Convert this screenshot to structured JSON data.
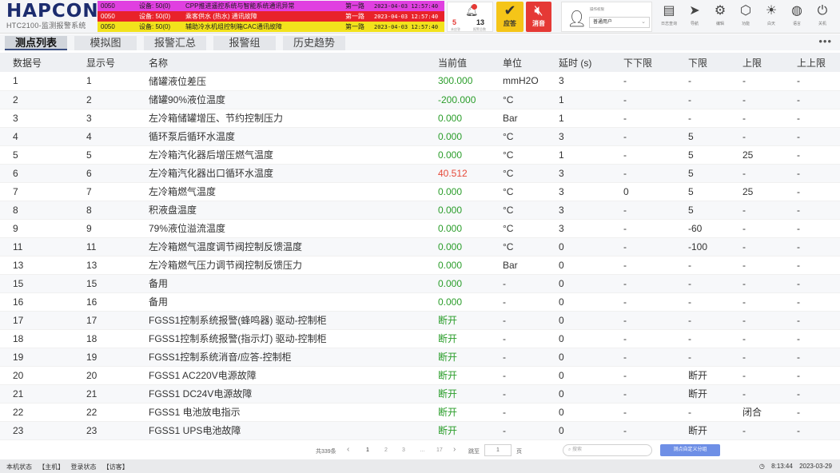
{
  "header": {
    "logo": "HAPCON",
    "subtitle": "HTC2100-监测报警系统"
  },
  "alarms": [
    {
      "id": "0050",
      "device": "设备: 50(0)",
      "message": "CPP推进遥控系统与智能系统通讯异常",
      "route": "第一路",
      "time": "2023-04-03 12:57:40",
      "bg": "#e040e0",
      "fg": "#1a1a1a"
    },
    {
      "id": "0050",
      "device": "设备: 50(0)",
      "message": "乘客供水 (热水) 通讯故障",
      "route": "第一路",
      "time": "2023-04-03 12:57:40",
      "bg": "#e8222a",
      "fg": "#ffffff"
    },
    {
      "id": "0050",
      "device": "设备: 50(0)",
      "message": "辅助冷水机组控制箱CAC通讯故障",
      "route": "第一路",
      "time": "2023-04-03 12:57:40",
      "bg": "#f2e21c",
      "fg": "#1a1a1a"
    }
  ],
  "counters": {
    "unacked": "5",
    "unacked_label": "未应答",
    "total": "13",
    "total_label": "报警总数"
  },
  "buttons": {
    "ack": "应答",
    "mute": "消音"
  },
  "user": {
    "label": "操作权限",
    "role": "普通用户"
  },
  "tools": [
    {
      "icon": "log-icon",
      "glyph": "▤",
      "label": "日志查询"
    },
    {
      "icon": "navigation-icon",
      "glyph": "➤",
      "label": "导航"
    },
    {
      "icon": "edit-gear-icon",
      "glyph": "⚙",
      "label": "编辑"
    },
    {
      "icon": "function-cube-icon",
      "glyph": "⬡",
      "label": "功能"
    },
    {
      "icon": "daytime-sun-icon",
      "glyph": "☀",
      "label": "白天"
    },
    {
      "icon": "language-icon",
      "glyph": "◍",
      "label": "语言"
    },
    {
      "icon": "power-icon",
      "glyph": "⏻",
      "label": "关机"
    }
  ],
  "tabs": [
    "测点列表",
    "模拟图",
    "报警汇总",
    "报警组",
    "历史趋势"
  ],
  "active_tab": 0,
  "table": {
    "headers": [
      "数据号",
      "显示号",
      "名称",
      "当前值",
      "单位",
      "延时 (s)",
      "下下限",
      "下限",
      "上限",
      "上上限"
    ],
    "rows": [
      [
        "1",
        "1",
        "储罐液位差压",
        "300.000",
        "mmH2O",
        "3",
        "-",
        "-",
        "-",
        "-"
      ],
      [
        "2",
        "2",
        "储罐90%液位温度",
        "-200.000",
        "°C",
        "1",
        "-",
        "-",
        "-",
        "-"
      ],
      [
        "3",
        "3",
        "左冷箱储罐增压、节约控制压力",
        "0.000",
        "Bar",
        "1",
        "-",
        "-",
        "-",
        "-"
      ],
      [
        "4",
        "4",
        "循环泵后循环水温度",
        "0.000",
        "°C",
        "3",
        "-",
        "5",
        "-",
        "-"
      ],
      [
        "5",
        "5",
        "左冷箱汽化器后增压燃气温度",
        "0.000",
        "°C",
        "1",
        "-",
        "5",
        "25",
        "-"
      ],
      [
        "6",
        "6",
        "左冷箱汽化器出口循环水温度",
        "40.512",
        "°C",
        "3",
        "-",
        "5",
        "-",
        "-"
      ],
      [
        "7",
        "7",
        "左冷箱燃气温度",
        "0.000",
        "°C",
        "3",
        "0",
        "5",
        "25",
        "-"
      ],
      [
        "8",
        "8",
        "积液盘温度",
        "0.000",
        "°C",
        "3",
        "-",
        "5",
        "-",
        "-"
      ],
      [
        "9",
        "9",
        "79%液位溢流温度",
        "0.000",
        "°C",
        "3",
        "-",
        "-60",
        "-",
        "-"
      ],
      [
        "11",
        "11",
        "左冷箱燃气温度调节阀控制反馈温度",
        "0.000",
        "°C",
        "0",
        "-",
        "-100",
        "-",
        "-"
      ],
      [
        "13",
        "13",
        "左冷箱燃气压力调节阀控制反馈压力",
        "0.000",
        "Bar",
        "0",
        "-",
        "-",
        "-",
        "-"
      ],
      [
        "15",
        "15",
        "备用",
        "0.000",
        "-",
        "0",
        "-",
        "-",
        "-",
        "-"
      ],
      [
        "16",
        "16",
        "备用",
        "0.000",
        "-",
        "0",
        "-",
        "-",
        "-",
        "-"
      ],
      [
        "17",
        "17",
        "FGSS1控制系统报警(蜂鸣器) 驱动-控制柜",
        "断开",
        "-",
        "0",
        "-",
        "-",
        "-",
        "-"
      ],
      [
        "18",
        "18",
        "FGSS1控制系统报警(指示灯) 驱动-控制柜",
        "断开",
        "-",
        "0",
        "-",
        "-",
        "-",
        "-"
      ],
      [
        "19",
        "19",
        "FGSS1控制系统消音/应答-控制柜",
        "断开",
        "-",
        "0",
        "-",
        "-",
        "-",
        "-"
      ],
      [
        "20",
        "20",
        "FGSS1 AC220V电源故障",
        "断开",
        "-",
        "0",
        "-",
        "断开",
        "-",
        "-"
      ],
      [
        "21",
        "21",
        "FGSS1 DC24V电源故障",
        "断开",
        "-",
        "0",
        "-",
        "断开",
        "-",
        "-"
      ],
      [
        "22",
        "22",
        "FGSS1 电池放电指示",
        "断开",
        "-",
        "0",
        "-",
        "-",
        "闭合",
        "-"
      ],
      [
        "23",
        "23",
        "FGSS1 UPS电池故障",
        "断开",
        "-",
        "0",
        "-",
        "断开",
        "-",
        "-"
      ]
    ],
    "value_colors": {
      "normal": "#2a9d2a",
      "alarm": "#e64a3a"
    },
    "alarm_rows": [
      5
    ]
  },
  "pager": {
    "total": "共339条",
    "pages": [
      "1",
      "2",
      "3",
      "…",
      "17"
    ],
    "current": "1",
    "goto_label": "跳至",
    "goto_value": "1",
    "page_label": "页",
    "search_placeholder": "搜索",
    "group_button": "测点自定义分组"
  },
  "status": {
    "machine_label": "本机状态",
    "machine_value": "【主机】",
    "login_label": "登录状态",
    "login_value": "【访客】",
    "time": "8:13:44",
    "date": "2023-03-29"
  }
}
